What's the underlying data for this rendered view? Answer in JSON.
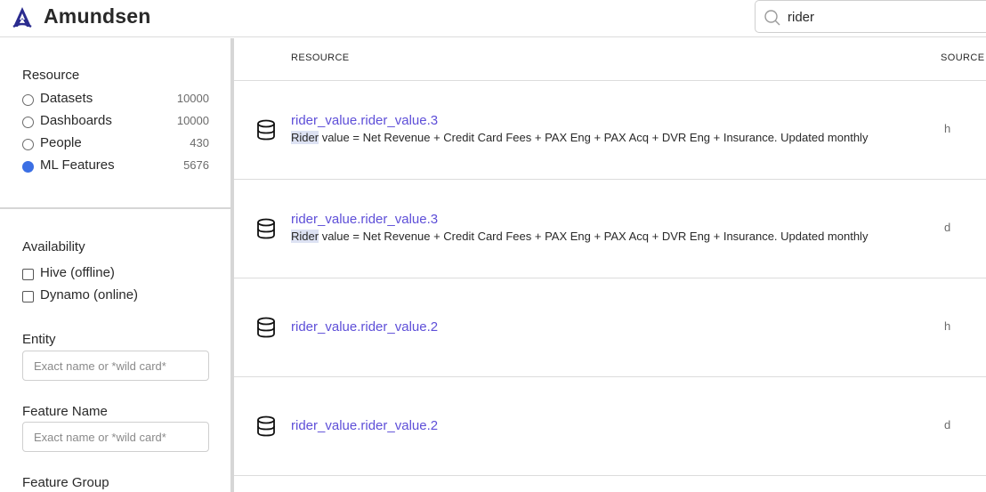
{
  "header": {
    "brand": "Amundsen",
    "search_value": "rider"
  },
  "sidebar": {
    "resource_title": "Resource",
    "resources": [
      {
        "label": "Datasets",
        "count": "10000",
        "selected": false
      },
      {
        "label": "Dashboards",
        "count": "10000",
        "selected": false
      },
      {
        "label": "People",
        "count": "430",
        "selected": false
      },
      {
        "label": "ML Features",
        "count": "5676",
        "selected": true
      }
    ],
    "availability_title": "Availability",
    "availability": [
      {
        "label": "Hive (offline)",
        "checked": false
      },
      {
        "label": "Dynamo (online)",
        "checked": false
      }
    ],
    "entity_title": "Entity",
    "entity_placeholder": "Exact name or *wild card*",
    "feature_name_title": "Feature Name",
    "feature_name_placeholder": "Exact name or *wild card*",
    "feature_group_title": "Feature Group"
  },
  "results": {
    "col_resource": "RESOURCE",
    "col_source": "SOURCE",
    "rows": [
      {
        "title": "rider_value.rider_value.3",
        "desc_highlight": "Rider",
        "desc_rest": " value = Net Revenue + Credit Card Fees + PAX Eng + PAX Acq + DVR Eng + Insurance. Updated monthly",
        "source": "h"
      },
      {
        "title": "rider_value.rider_value.3",
        "desc_highlight": "Rider",
        "desc_rest": " value = Net Revenue + Credit Card Fees + PAX Eng + PAX Acq + DVR Eng + Insurance. Updated monthly",
        "source": "d"
      },
      {
        "title": "rider_value.rider_value.2",
        "desc_highlight": "",
        "desc_rest": "",
        "source": "h"
      },
      {
        "title": "rider_value.rider_value.2",
        "desc_highlight": "",
        "desc_rest": "",
        "source": "d"
      }
    ]
  },
  "colors": {
    "accent": "#5e4fd8",
    "radio_selected": "#3b6fe4",
    "highlight": "#dde2f3"
  }
}
